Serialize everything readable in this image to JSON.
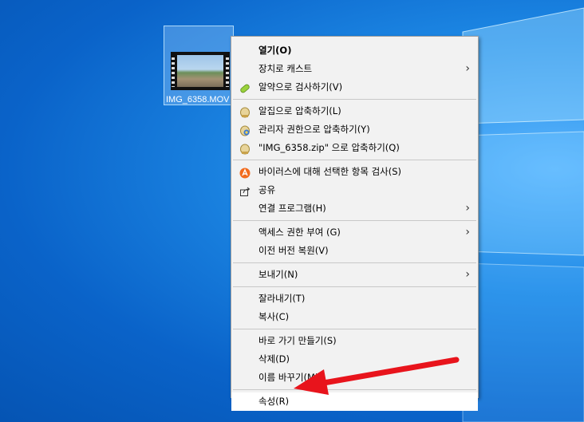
{
  "file": {
    "name": "IMG_6358.MOV"
  },
  "menu": {
    "groups": [
      [
        {
          "label": "열기(O)",
          "bold": true
        },
        {
          "label": "장치로 캐스트",
          "submenu": true
        },
        {
          "label": "알약으로 검사하기(V)",
          "icon": "pill-icon"
        }
      ],
      [
        {
          "label": "알집으로 압축하기(L)",
          "icon": "alzip-icon"
        },
        {
          "label": "관리자 권한으로 압축하기(Y)",
          "icon": "alzip-admin-icon"
        },
        {
          "label": "\"IMG_6358.zip\" 으로 압축하기(Q)",
          "icon": "alzip-icon"
        }
      ],
      [
        {
          "label": "바이러스에 대해 선택한 항목 검사(S)",
          "icon": "avast-icon"
        },
        {
          "label": "공유",
          "icon": "share-icon"
        },
        {
          "label": "연결 프로그램(H)",
          "submenu": true
        }
      ],
      [
        {
          "label": "액세스 권한 부여 (G)",
          "submenu": true
        },
        {
          "label": "이전 버전 복원(V)"
        }
      ],
      [
        {
          "label": "보내기(N)",
          "submenu": true
        }
      ],
      [
        {
          "label": "잘라내기(T)"
        },
        {
          "label": "복사(C)"
        }
      ],
      [
        {
          "label": "바로 가기 만들기(S)"
        },
        {
          "label": "삭제(D)"
        },
        {
          "label": "이름 바꾸기(M)"
        }
      ],
      [
        {
          "label": "속성(R)",
          "highlight": true
        }
      ]
    ]
  },
  "colors": {
    "desktop": "#0a63c9",
    "menu_bg": "#f2f2f2",
    "annotation_arrow": "#e8141c"
  }
}
